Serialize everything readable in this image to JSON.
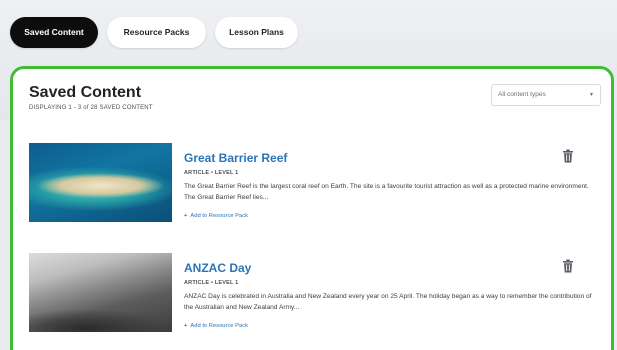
{
  "tabs": [
    {
      "label": "Saved Content",
      "active": true
    },
    {
      "label": "Resource Packs",
      "active": false
    },
    {
      "label": "Lesson Plans",
      "active": false
    }
  ],
  "panel": {
    "title": "Saved Content",
    "subtitle": "DISPLAYING 1 - 3 of 28 SAVED CONTENT",
    "filter": {
      "value": "All content types",
      "icon": "chevron-down-icon"
    }
  },
  "items": [
    {
      "title": "Great Barrier Reef",
      "meta": "ARTICLE • LEVEL 1",
      "description": "The Great Barrier Reef is the largest coral reef on Earth. The site is a favourite tourist attraction as well as a protected marine environment. The Great Barrier Reef lies...",
      "add_label": "Add to Resource Pack",
      "thumbnail": "aerial photo of a coral reef"
    },
    {
      "title": "ANZAC Day",
      "meta": "ARTICLE • LEVEL 1",
      "description": "ANZAC Day is celebrated in Australia and New Zealand every year on 25 April. The holiday began as a way to remember the contribution of the Australian and New Zealand Army...",
      "add_label": "Add to Resource Pack",
      "thumbnail": "black and white photo of a hillside"
    }
  ],
  "colors": {
    "accent_green": "#3fbd31",
    "link_blue": "#2a74b8",
    "active_tab": "#0d0d0d"
  }
}
